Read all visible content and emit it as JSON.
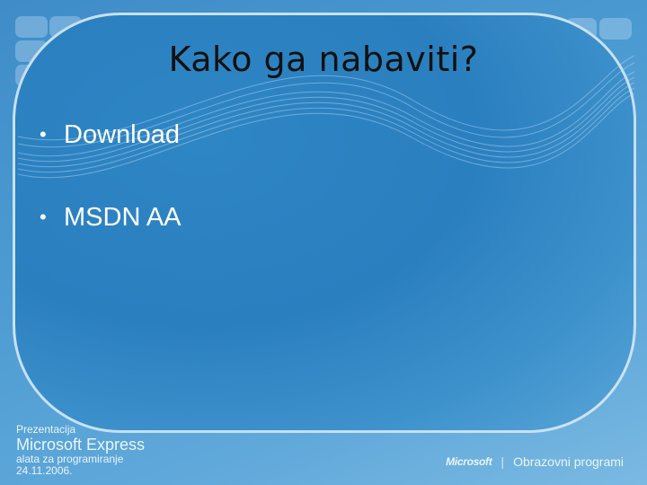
{
  "slide": {
    "title": "Kako ga nabaviti?",
    "bullets": [
      {
        "marker": "•",
        "text": "Download"
      },
      {
        "marker": "•",
        "text": "MSDN AA"
      }
    ]
  },
  "footer": {
    "left": {
      "line1": "Prezentacija",
      "line2": "Microsoft Express",
      "line3": "alata za programiranje",
      "line4": "24.11.2006."
    },
    "right": {
      "brand": "Microsoft",
      "separator": "|",
      "program": "Obrazovni programi"
    }
  },
  "colors": {
    "background": "#4c9bd2",
    "panel": "#2a7fbf",
    "title_text": "#111111",
    "bullet_text": "#ffffff",
    "outline": "#e1f0fa"
  }
}
